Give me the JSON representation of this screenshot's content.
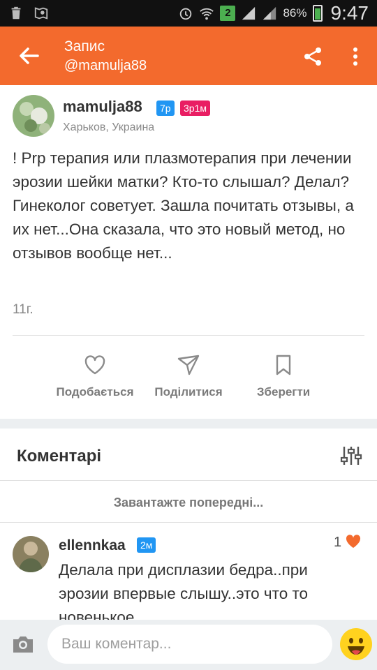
{
  "status_bar": {
    "sim_slot": "2",
    "battery_percent": "86%",
    "time": "9:47",
    "icons": [
      "trash-icon",
      "map-icon",
      "alarm-icon",
      "wifi-icon",
      "signal-icon",
      "battery-icon"
    ]
  },
  "app_bar": {
    "title": "Запис",
    "subtitle": "@mamulja88",
    "icons": [
      "back-arrow-icon",
      "share-icon",
      "more-vertical-icon"
    ]
  },
  "post": {
    "author": "mamulja88",
    "badge_rating": "7р",
    "badge_age": "3р1м",
    "location": "Харьков, Украина",
    "text": "! Prp терапия или плазмотерапия при лечении эрозии шейки матки? Кто-то слышал? Делал? Гинеколог советует. Зашла почитать отзывы, а их нет...Она сказала, что это новый метод, но отзывов вообще нет...",
    "age": "11г.",
    "actions": {
      "like": "Подобається",
      "share": "Поділитися",
      "save": "Зберегти"
    }
  },
  "comments": {
    "title": "Коментарі",
    "load_previous": "Завантажте попередні...",
    "items": [
      {
        "author": "ellennkaa",
        "badge": "2м",
        "likes": "1",
        "text": "Делала при дисплазии бедра..при эрозии впервые слышу..это что то новенькое"
      }
    ]
  },
  "composer": {
    "placeholder": "Ваш коментар..."
  },
  "colors": {
    "accent": "#f36a2d",
    "badge_blue": "#2196f3",
    "badge_pink": "#e91e63",
    "heart": "#f36a2d"
  }
}
